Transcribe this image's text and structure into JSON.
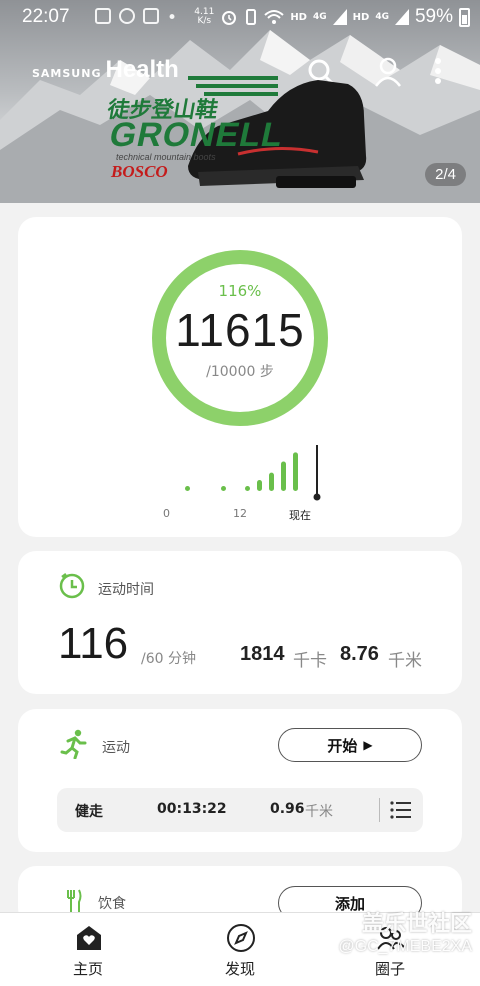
{
  "status_bar": {
    "time": "22:07",
    "net_speed": "4.11",
    "net_unit": "K/s",
    "hd1": "HD",
    "lte1": "4G",
    "hd2": "HD",
    "lte2": "4G",
    "battery": "59%"
  },
  "banner": {
    "brand_samsung": "SAMSUNG",
    "brand_health": "Health",
    "ad_chinese": "徒步登山鞋",
    "ad_brand": "GRONELL",
    "ad_subtitle": "technical mountain boots",
    "ad_maker": "BOSCO",
    "pager": "2/4"
  },
  "steps": {
    "percent": "116%",
    "count": "11615",
    "goal": "/10000 步",
    "progress_fraction": 1.0,
    "x_label_0": "0",
    "x_label_12": "12",
    "x_label_now": "现在",
    "hourly_levels": [
      0.08,
      0.08,
      0.08,
      0.24,
      0.4,
      0.64,
      0.84,
      1.0
    ]
  },
  "active_time": {
    "label": "运动时间",
    "value": "116",
    "goal": "/60 分钟",
    "calories_value": "1814",
    "calories_unit": "千卡",
    "distance_value": "8.76",
    "distance_unit": "千米"
  },
  "exercise": {
    "label": "运动",
    "start_button": "开始",
    "type": "健走",
    "duration": "00:13:22",
    "distance_value": "0.96",
    "distance_unit": "千米"
  },
  "food": {
    "label": "饮食",
    "add_button": "添加"
  },
  "bottom_nav": {
    "home": "主页",
    "discover": "发现",
    "community": "圈子"
  },
  "watermark": {
    "line1": "盖乐世社区",
    "line2": "@GC_7MEBE2XA"
  },
  "colors": {
    "accent_green": "#6abf4b",
    "ring_green": "#8dd16a",
    "card_bg": "#ffffff",
    "page_bg": "#f2f2f2"
  }
}
